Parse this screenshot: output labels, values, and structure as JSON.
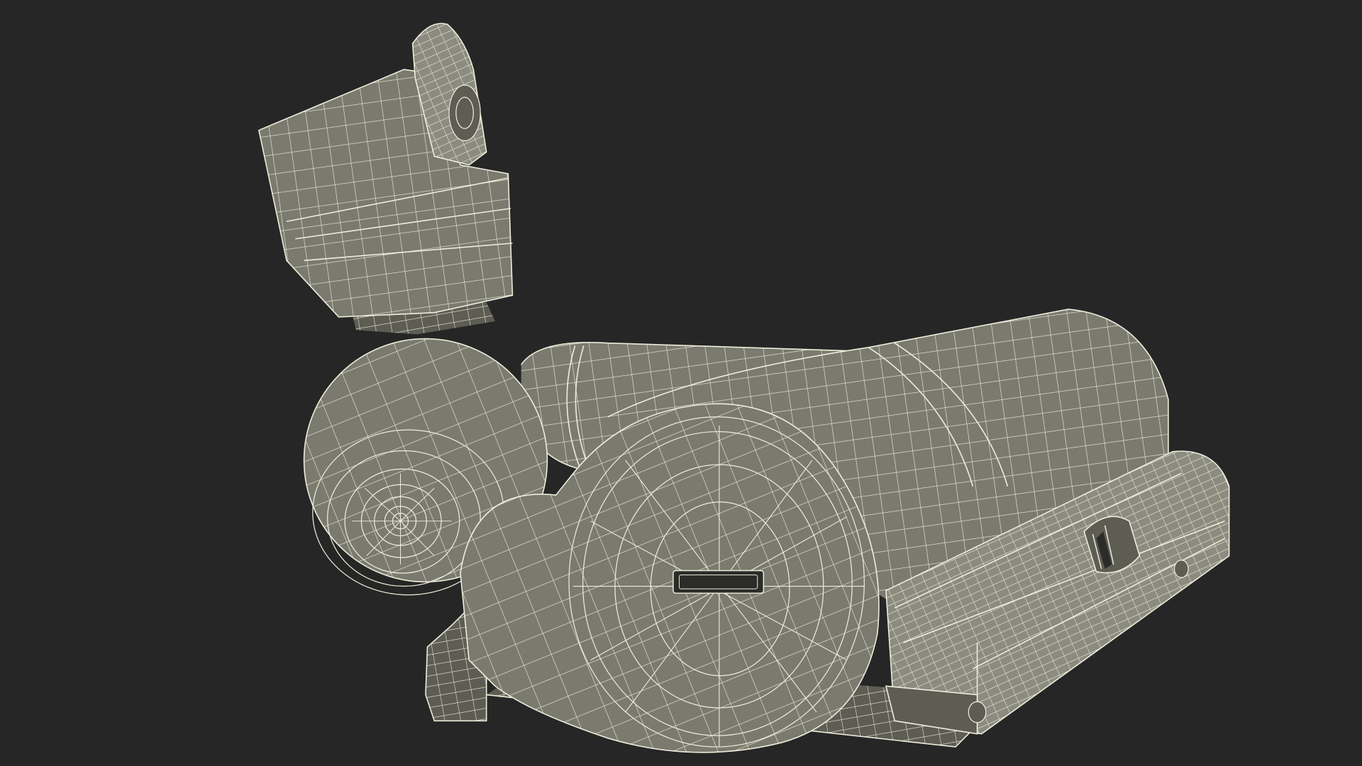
{
  "scene": {
    "subject": "wireframe-vacuum-head-model",
    "colors": {
      "background": "#262626",
      "surface": "#7a7a6e",
      "surface_dark": "#5d5d54",
      "surface_light": "#8b8b7f",
      "wire": "#eeeedd",
      "slot": "#2b2b28"
    }
  }
}
